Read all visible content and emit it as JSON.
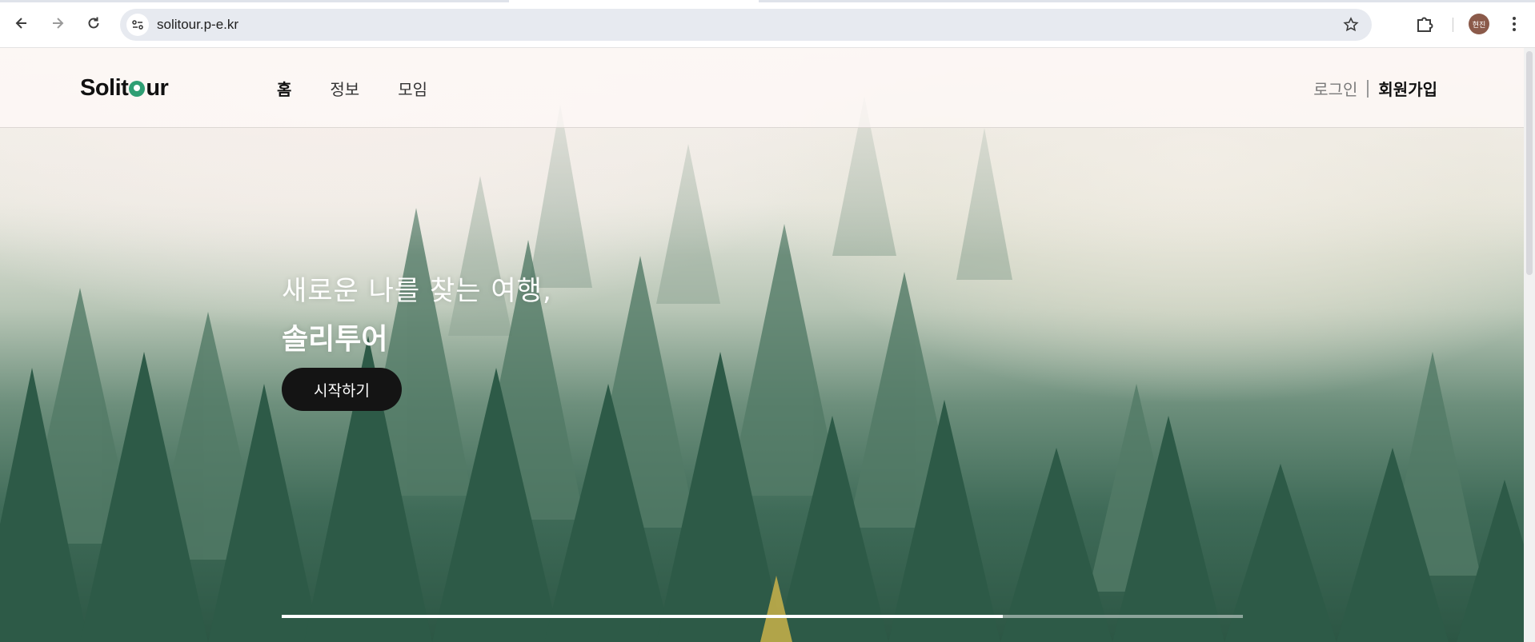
{
  "browser": {
    "url": "solitour.p-e.kr",
    "profile_initials": "현진",
    "icons": [
      "back-arrow-icon",
      "forward-arrow-icon",
      "reload-icon",
      "site-settings-icon",
      "bookmark-star-icon",
      "extensions-puzzle-icon",
      "more-vert-icon"
    ]
  },
  "site": {
    "logo": {
      "prefix": "Solit",
      "suffix": "ur"
    },
    "nav": [
      {
        "label": "홈",
        "active": true
      },
      {
        "label": "정보",
        "active": false
      },
      {
        "label": "모임",
        "active": false
      }
    ],
    "auth": {
      "login": "로그인",
      "signup": "회원가입"
    }
  },
  "hero": {
    "line1": "새로운 나를 찾는 여행,",
    "line2": "솔리투어",
    "cta": "시작하기",
    "slide_progress": 0.75
  },
  "colors": {
    "accent_green": "#2f9f74",
    "cta_bg": "#141414",
    "chrome_omnibox": "#e7eaf0"
  }
}
